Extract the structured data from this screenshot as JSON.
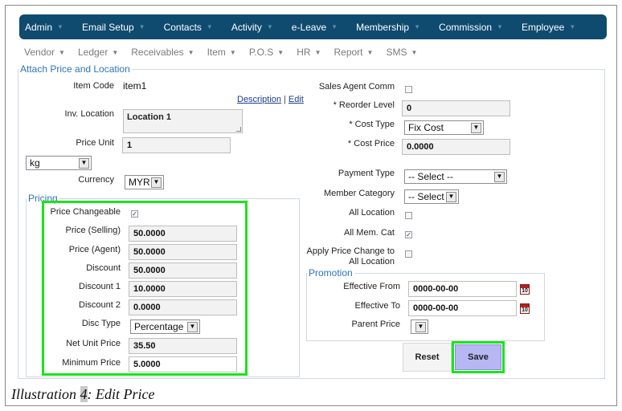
{
  "nav": [
    "Admin",
    "Email Setup",
    "Contacts",
    "Activity",
    "e-Leave",
    "Membership",
    "Commission",
    "Employee"
  ],
  "subnav": [
    "Vendor",
    "Ledger",
    "Receivables",
    "Item",
    "P.O.S",
    "HR",
    "Report",
    "SMS"
  ],
  "section_title": "Attach Price and Location",
  "left": {
    "item_code_label": "Item Code",
    "item_code_value": "item1",
    "description_link": "Description",
    "edit_link": "Edit",
    "link_separator": "|",
    "inv_location_label": "Inv. Location",
    "inv_location_value": "Location 1",
    "price_unit_label": "Price Unit",
    "price_unit_value": "1",
    "uom_value": "kg",
    "currency_label": "Currency",
    "currency_value": "MYR"
  },
  "pricing": {
    "legend": "Pricing",
    "price_changeable_label": "Price Changeable",
    "price_changeable_checked": true,
    "fields": [
      {
        "label": "Price (Selling)",
        "value": "50.0000"
      },
      {
        "label": "Price (Agent)",
        "value": "50.0000"
      },
      {
        "label": "Discount",
        "value": "50.0000"
      },
      {
        "label": "Discount 1",
        "value": "10.0000"
      },
      {
        "label": "Discount 2",
        "value": "0.0000"
      }
    ],
    "disc_type_label": "Disc Type",
    "disc_type_value": "Percentage",
    "net_unit_price_label": "Net Unit Price",
    "net_unit_price_value": "35.50",
    "minimum_price_label": "Minimum Price",
    "minimum_price_value": "5.0000"
  },
  "right": {
    "sales_agent_comm_label": "Sales Agent Comm",
    "sales_agent_comm_checked": false,
    "reorder_level_label": "* Reorder Level",
    "reorder_level_value": "0",
    "cost_type_label": "* Cost Type",
    "cost_type_value": "Fix Cost",
    "cost_price_label": "* Cost Price",
    "cost_price_value": "0.0000",
    "payment_type_label": "Payment Type",
    "payment_type_value": "-- Select --",
    "member_category_label": "Member Category",
    "member_category_value": "-- Select",
    "all_location_label": "All Location",
    "all_location_checked": false,
    "all_mem_cat_label": "All Mem. Cat",
    "all_mem_cat_checked": true,
    "apply_price_change_label_1": "Apply Price Change to",
    "apply_price_change_label_2": "All Location",
    "apply_price_change_checked": false
  },
  "promotion": {
    "legend": "Promotion",
    "effective_from_label": "Effective From",
    "effective_from_value": "0000-00-00",
    "effective_to_label": "Effective To",
    "effective_to_value": "0000-00-00",
    "parent_price_label": "Parent Price",
    "parent_price_value": "",
    "calendar_day": "10"
  },
  "buttons": {
    "reset": "Reset",
    "save": "Save"
  },
  "caption": {
    "prefix": "Illustration ",
    "number": "4",
    "suffix": ": Edit Price"
  },
  "colors": {
    "nav_bg": "#0f4a6f",
    "legend": "#2e74b5",
    "highlight": "#19e519",
    "save_bg": "#b7b7f3"
  }
}
